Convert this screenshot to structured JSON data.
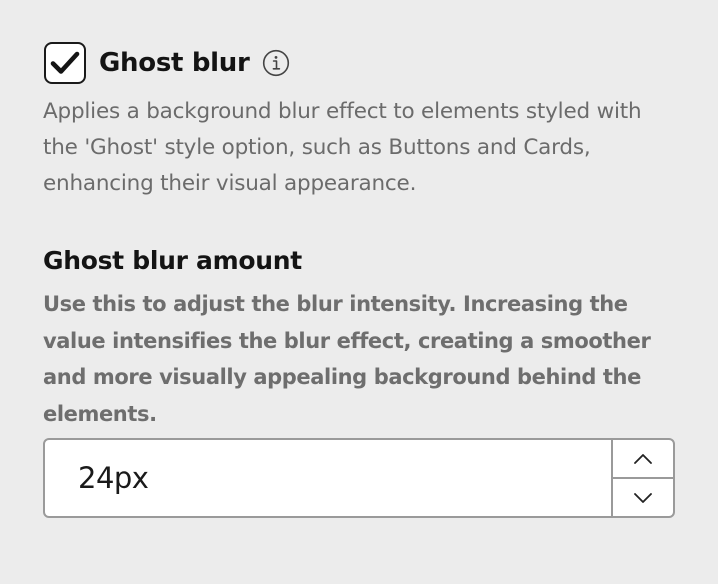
{
  "ghost_blur": {
    "checked": true,
    "label": "Ghost blur",
    "info_icon": "info-circle-icon",
    "description": "Applies a background blur effect to elements styled with the 'Ghost' style option, such as Buttons and Cards, enhancing their visual appearance."
  },
  "ghost_blur_amount": {
    "title": "Ghost blur amount",
    "helper": "Use this to adjust the blur intensity. Increasing the value intensifies the blur effect, creating a smoother and more visually appealing background behind the elements.",
    "value": "24px",
    "increment_icon": "chevron-up-icon",
    "decrement_icon": "chevron-down-icon"
  },
  "colors": {
    "background": "#ececec",
    "text_primary": "#141414",
    "text_secondary": "#6b6b6b",
    "border": "#9a9a9a"
  }
}
